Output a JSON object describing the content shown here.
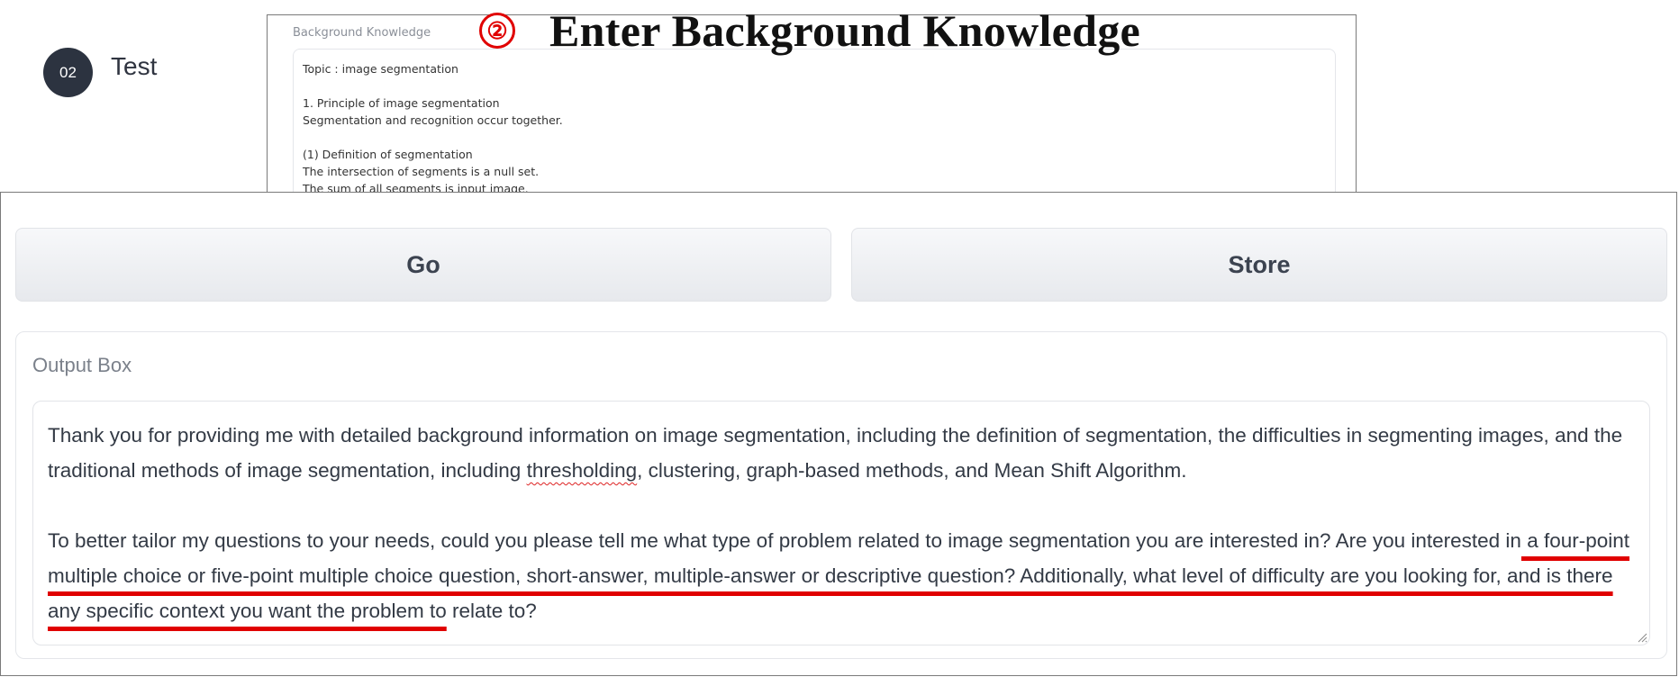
{
  "step": {
    "number": "02",
    "label": "Test"
  },
  "background_knowledge": {
    "title": "Background Knowledge",
    "lines": [
      "Topic : image segmentation",
      "",
      "1. Principle of image segmentation",
      "Segmentation and recognition occur together.",
      "",
      "(1) Definition of segmentation",
      "The intersection of segments is a null set.",
      "The sum of all segments is input image."
    ]
  },
  "annotation": {
    "number": "②",
    "text": "Enter Background Knowledge",
    "color": "#e00000"
  },
  "buttons": {
    "go": "Go",
    "store": "Store"
  },
  "output": {
    "label": "Output Box",
    "p1_a": "Thank you for providing me with detailed background information on image segmentation, including the definition of segmentation, the difficulties in segmenting images, and the traditional methods of image segmentation, including ",
    "p1_misspelled": "thresholding",
    "p1_b": ", clustering, graph-based methods, and Mean Shift Algorithm.",
    "p2_a": "To better tailor my questions to your needs, could you please tell me what type of problem related to image segmentation you are interested in? Are you interested in",
    "p2_highlight": " a four-point multiple choice or five-point multiple choice question, short-answer, multiple-answer or descriptive question? Additionally, what level of difficulty are you looking for, and is there any specific context you want the problem to",
    "p2_b": " relate to?"
  },
  "colors": {
    "badge": "#2c3340",
    "highlight": "#e00000",
    "button_text": "#3c4350"
  }
}
